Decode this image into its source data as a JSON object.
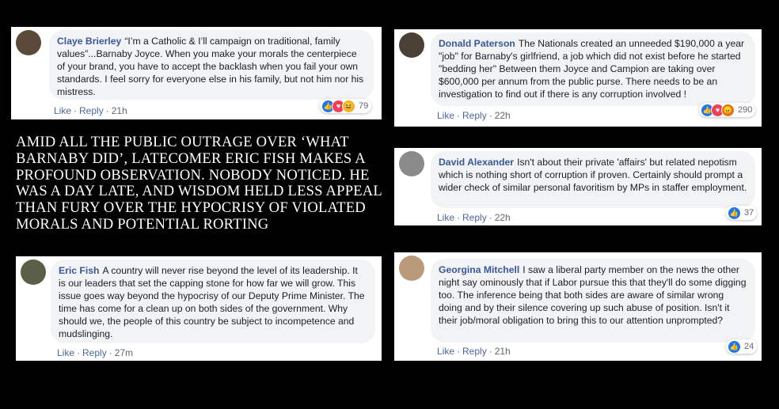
{
  "headline": "AMID ALL THE PUBLIC OUTRAGE OVER ‘WHAT BARNABY DID’, LATECOMER ERIC FISH MAKES A PROFOUND OBSERVATION. NOBODY NOTICED. HE WAS A DAY LATE, AND WISDOM HELD LESS APPEAL THAN FURY OVER THE HYPOCRISY OF VIOLATED MORALS AND POTENTIAL RORTING",
  "comments": [
    {
      "name": "Claye Brierley",
      "text": "“I’m a Catholic & I’ll campaign on traditional, family values”...Barnaby Joyce. When you make your morals the centerpiece of your brand, you have to accept the backlash when you fail your own standards. I feel sorry for everyone else in his family, but not him nor his mistress.",
      "like": "Like",
      "reply": "Reply",
      "time": "21h",
      "reactions": [
        "like",
        "love",
        "haha"
      ],
      "count": "79"
    },
    {
      "name": "Donald Paterson",
      "text": "The Nationals created an unneeded $190,000 a year \"job\" for Barnaby's girlfriend, a job which did not exist before he started \"bedding her\" Between them Joyce and Campion are taking over $600,000 per annum from the public purse. There needs to be an investigation to find out if there is any corruption involved !",
      "like": "Like",
      "reply": "Reply",
      "time": "22h",
      "reactions": [
        "like",
        "love",
        "angry"
      ],
      "count": "290"
    },
    {
      "name": "David Alexander",
      "text": "Isn't about their private 'affairs' but related nepotism which is nothing short of corruption if proven. Certainly should prompt a wider check of similar personal favoritism by MPs in staffer employment.",
      "like": "Like",
      "reply": "Reply",
      "time": "22h",
      "reactions": [
        "like"
      ],
      "count": "37"
    },
    {
      "name": "Eric Fish",
      "text": "A country will never rise beyond the level of its leadership. It is our leaders that set the capping stone for how far we will grow. This issue goes way beyond the hypocrisy of our Deputy Prime Minister. The time has come for a clean up on both sides of the government. Why should we, the people of this country be subject to incompetence and mudslinging.",
      "like": "Like",
      "reply": "Reply",
      "time": "27m"
    },
    {
      "name": "Georgina Mitchell",
      "text": "I saw a liberal party member on the news the other night say ominously that if Labor pursue this that they'll do some digging too. The inference being that both sides are aware of similar wrong doing and by their silence covering up such abuse of position. Isn't it their job/moral obligation to bring this to our attention unprompted?",
      "like": "Like",
      "reply": "Reply",
      "time": "21h",
      "reactions": [
        "like"
      ],
      "count": "24"
    }
  ],
  "colors": {
    "name": "#385898",
    "bubble": "#f2f3f5",
    "link": "#4b67a1",
    "like": "#1877f2",
    "love": "#f33e58",
    "haha": "#f7b125",
    "angry": "#e9710f"
  },
  "icons": [
    "thumbs-up-icon",
    "heart-icon",
    "laughing-face-icon",
    "angry-face-icon"
  ]
}
